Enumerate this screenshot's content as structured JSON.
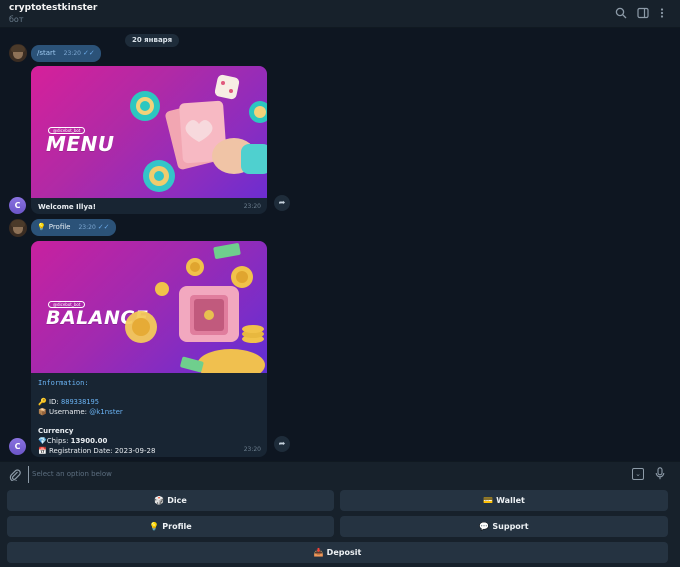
{
  "header": {
    "title": "cryptotestkinster",
    "subtitle": "бот"
  },
  "chat": {
    "date_label": "20 января",
    "messages": [
      {
        "type": "outgoing",
        "text": "/start",
        "time": "23:20"
      },
      {
        "type": "bot_card",
        "banner_handle": "@dicebot_bot",
        "banner_word": "MENU",
        "caption": "Welcome Illya!",
        "time": "23:20"
      },
      {
        "type": "outgoing",
        "emoji": "💡",
        "text": "Profile",
        "time": "23:20"
      },
      {
        "type": "bot_card",
        "banner_handle": "@dicebot_bot",
        "banner_word": "BALANCE",
        "info_header": "Information:",
        "id_label": "ID:",
        "id_value": "889338195",
        "username_label": "Username:",
        "username_value": "@k1nster",
        "currency_header": "Currency",
        "chips_label": "Chips:",
        "chips_value": "13900.00",
        "reg_label": "Registration Date:",
        "reg_value": "2023-09-28",
        "time": "23:20"
      }
    ],
    "bot_avatar_letter": "C"
  },
  "input": {
    "placeholder": "Select an option below"
  },
  "keyboard": {
    "buttons": [
      {
        "emoji": "🎲",
        "label": "Dice"
      },
      {
        "emoji": "💳",
        "label": "Wallet"
      },
      {
        "emoji": "💡",
        "label": "Profile"
      },
      {
        "emoji": "💬",
        "label": "Support"
      },
      {
        "emoji": "📥",
        "label": "Deposit"
      }
    ]
  },
  "colors": {
    "background": "#0e1621",
    "outgoing_bubble": "#2b5278",
    "incoming_bubble": "#182533",
    "keyboard_button": "#253341",
    "accent": "#6ab3f3"
  }
}
